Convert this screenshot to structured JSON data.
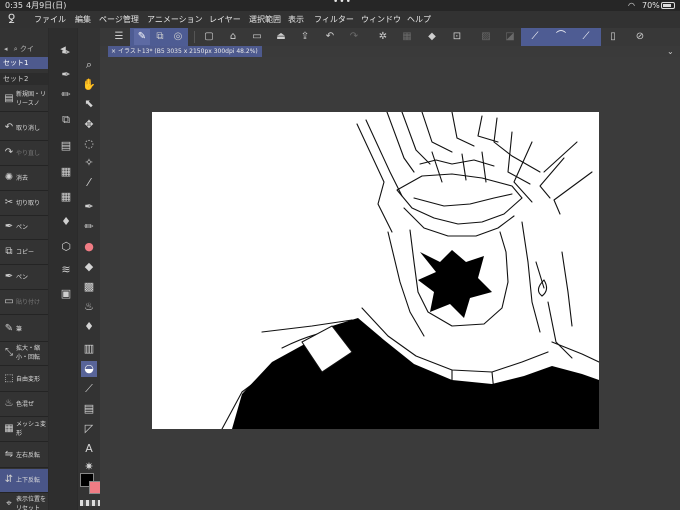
{
  "status_bar": {
    "time": "0:35",
    "date": "4月9日(日)",
    "dots": "•••",
    "battery": "70%"
  },
  "menu": {
    "items": [
      "ファイル",
      "編集",
      "ページ管理",
      "アニメーション",
      "レイヤー",
      "選択範囲",
      "表示",
      "フィルター",
      "ウィンドウ",
      "ヘルプ"
    ]
  },
  "quick_access": {
    "search_placeholder": "クイ",
    "sets": [
      "セット1",
      "セット2"
    ],
    "items": [
      {
        "label": "新規固・リリースノ",
        "icon": "new-file-icon"
      },
      {
        "label": "取り消し",
        "icon": "undo-icon"
      },
      {
        "label": "やり直し",
        "icon": "redo-icon"
      },
      {
        "label": "消去",
        "icon": "clear-icon"
      },
      {
        "label": "切り取り",
        "icon": "cut-icon"
      },
      {
        "label": "ペン",
        "icon": "pen-icon"
      },
      {
        "label": "コピー",
        "icon": "copy-icon"
      },
      {
        "label": "ペン",
        "icon": "pen-icon"
      },
      {
        "label": "貼り付け",
        "icon": "paste-icon"
      },
      {
        "label": "筆",
        "icon": "brush-icon"
      },
      {
        "label": "拡大・縮小・回転",
        "icon": "scale-icon"
      },
      {
        "label": "自由変形",
        "icon": "free-transform-icon"
      },
      {
        "label": "色混ぜ",
        "icon": "blend-icon"
      },
      {
        "label": "メッシュ変形",
        "icon": "mesh-icon"
      },
      {
        "label": "左右反転",
        "icon": "flip-horizontal-icon"
      },
      {
        "label": "上下反転",
        "icon": "flip-vertical-icon"
      },
      {
        "label": "表示位置をリセット",
        "icon": "reset-view-icon"
      }
    ]
  },
  "document": {
    "tab_label": "イラスト13* (B5 3035 x 2150px 300dpi 48.2%)"
  },
  "colors": {
    "accent": "#5d6aa3",
    "main_color": "#000000",
    "sub_color": "#f07c84"
  }
}
